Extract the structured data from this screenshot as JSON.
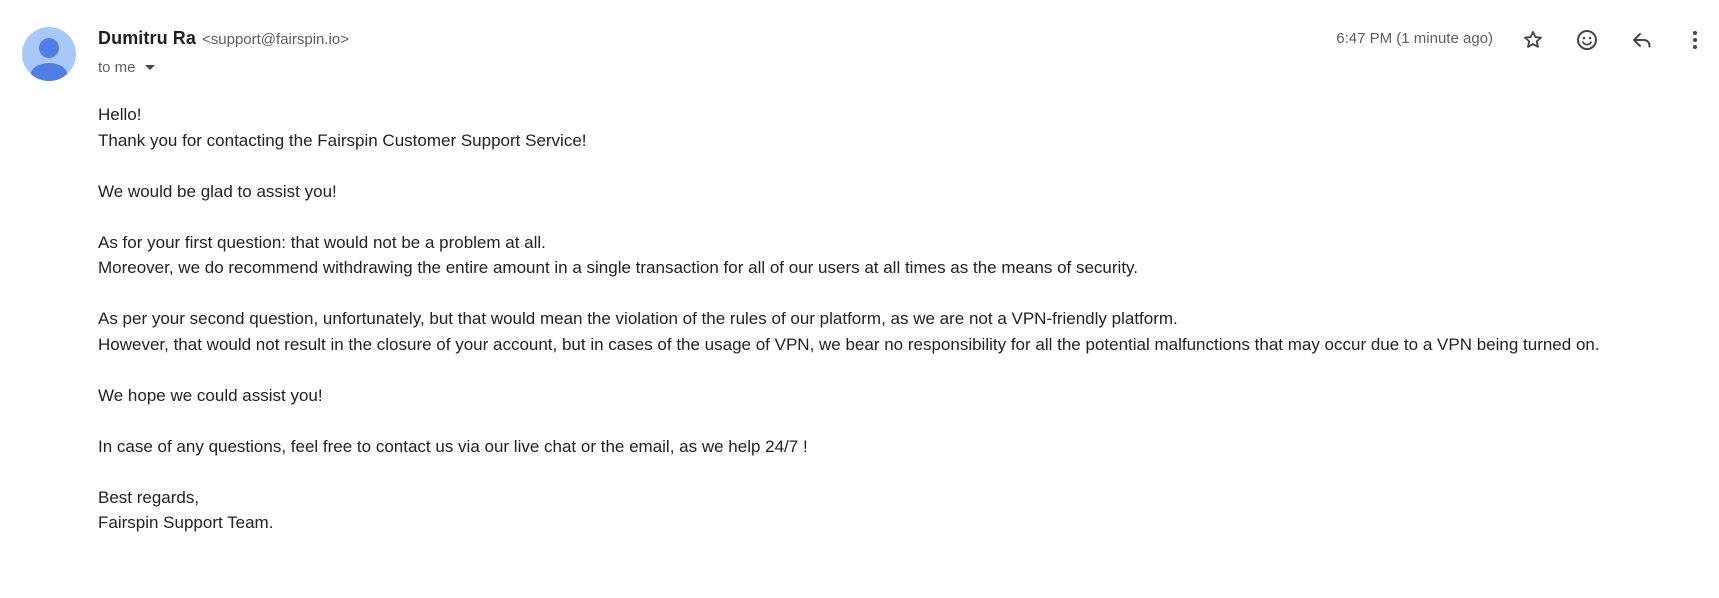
{
  "sender": {
    "name": "Dumitru Ra",
    "email": "<support@fairspin.io>"
  },
  "recipient": {
    "label": "to me",
    "icon": "chevron-down-icon"
  },
  "timestamp": "6:47 PM (1 minute ago)",
  "actions": {
    "star_icon": "star-icon",
    "emoji_icon": "emoji-icon",
    "reply_icon": "reply-icon",
    "more_icon": "more-vert-icon"
  },
  "avatar": {
    "icon": "person-avatar-icon",
    "bg_color": "#a8c7fa",
    "fg_color": "#4f7fe6"
  },
  "message": {
    "p1": [
      "Hello!",
      "Thank you for contacting the Fairspin Customer Support Service!"
    ],
    "p2": [
      "We would be glad to assist you!"
    ],
    "p3": [
      "As for your first question: that would not be a problem at all.",
      "Moreover, we do recommend withdrawing the entire amount in a single transaction for all of our users at all times as the means of security."
    ],
    "p4": [
      "As per your second question, unfortunately, but that would mean the violation of the rules of our platform, as we are not a VPN-friendly platform.",
      "However, that would not result in the closure of your account, but in cases of the usage of VPN, we bear no responsibility for all the potential malfunctions that may occur due to a VPN being turned on."
    ],
    "p5": [
      "We hope we could assist you!"
    ],
    "p6": [
      "In case of any questions, feel free to contact us via our live chat or the email, as we help 24/7 !"
    ],
    "p7": [
      "Best regards,",
      "Fairspin Support Team."
    ]
  }
}
